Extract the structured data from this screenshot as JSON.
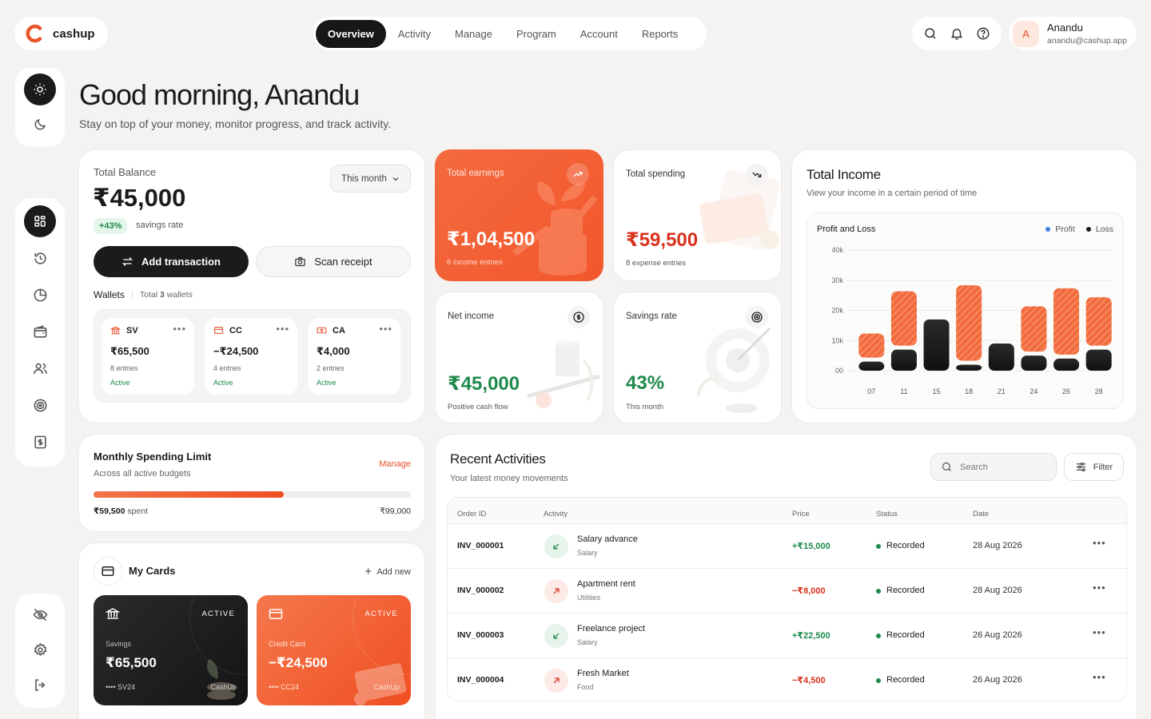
{
  "app": {
    "name": "cashup"
  },
  "nav": {
    "items": [
      "Overview",
      "Activity",
      "Manage",
      "Program",
      "Account",
      "Reports"
    ],
    "active": 0
  },
  "user": {
    "initial": "A",
    "name": "Anandu",
    "email": "anandu@cashup.app"
  },
  "greeting": {
    "title": "Good morning, Anandu",
    "subtitle": "Stay on top of your money, monitor progress, and track activity."
  },
  "balance": {
    "label": "Total Balance",
    "value": "₹45,000",
    "period": "This month",
    "badge": "+43%",
    "badge_text": "savings rate",
    "add_btn": "Add transaction",
    "scan_btn": "Scan receipt"
  },
  "wallets": {
    "title": "Wallets",
    "total_prefix": "Total",
    "total_count": "3",
    "total_suffix": "wallets",
    "items": [
      {
        "code": "SV",
        "value": "₹65,500",
        "entries": "8 entries",
        "status": "Active"
      },
      {
        "code": "CC",
        "value": "−₹24,500",
        "entries": "4 entries",
        "status": "Active"
      },
      {
        "code": "CA",
        "value": "₹4,000",
        "entries": "2 entries",
        "status": "Active"
      }
    ]
  },
  "stats": {
    "earnings": {
      "label": "Total earnings",
      "value": "₹1,04,500",
      "sub": "6 income entries"
    },
    "spending": {
      "label": "Total spending",
      "value": "₹59,500",
      "sub": "8 expense entries"
    },
    "net": {
      "label": "Net income",
      "value": "₹45,000",
      "sub": "Positive cash flow"
    },
    "savings": {
      "label": "Savings rate",
      "value": "43%",
      "sub": "This month"
    }
  },
  "income": {
    "title": "Total Income",
    "subtitle": "View your income in a certain period of time",
    "chart_title": "Profit and Loss",
    "legend_profit": "Profit",
    "legend_loss": "Loss"
  },
  "chart_data": {
    "type": "bar",
    "title": "Profit and Loss",
    "categories": [
      "07",
      "11",
      "15",
      "18",
      "21",
      "24",
      "26",
      "28"
    ],
    "y_ticks": [
      "00",
      "10k",
      "20k",
      "30k",
      "40k"
    ],
    "ylim": [
      0,
      40000
    ],
    "series": [
      {
        "name": "Profit",
        "values": [
          8000,
          18000,
          0,
          25000,
          0,
          15000,
          22000,
          16000
        ]
      },
      {
        "name": "Loss",
        "values": [
          3000,
          7000,
          17000,
          2000,
          9000,
          5000,
          4000,
          7000
        ]
      }
    ],
    "colors": {
      "Profit": "#f26a3b",
      "Loss": "#1e1e1e"
    },
    "legend": "top-right",
    "grid": true
  },
  "limit": {
    "title": "Monthly Spending Limit",
    "subtitle": "Across all active budgets",
    "manage": "Manage",
    "spent": "₹59,500",
    "spent_suffix": "spent",
    "total": "₹99,000",
    "progress": 0.6
  },
  "cards": {
    "title": "My Cards",
    "add": "Add new",
    "items": [
      {
        "status": "ACTIVE",
        "type": "Savings",
        "value": "₹65,500",
        "number": "•••• SV24",
        "brand": "CashUp"
      },
      {
        "status": "ACTIVE",
        "type": "Credit Card",
        "value": "−₹24,500",
        "number": "•••• CC24",
        "brand": "CashUp"
      }
    ]
  },
  "recent": {
    "title": "Recent Activities",
    "subtitle": "Your latest money movements",
    "search_placeholder": "Search",
    "filter": "Filter",
    "columns": [
      "Order ID",
      "Activity",
      "Price",
      "Status",
      "Date"
    ],
    "rows": [
      {
        "id": "INV_000001",
        "name": "Salary advance",
        "cat": "Salary",
        "price": "+₹15,000",
        "status": "Recorded",
        "date": "28 Aug 2026",
        "dir": "in"
      },
      {
        "id": "INV_000002",
        "name": "Apartment rent",
        "cat": "Utilities",
        "price": "−₹8,000",
        "status": "Recorded",
        "date": "28 Aug 2026",
        "dir": "out"
      },
      {
        "id": "INV_000003",
        "name": "Freelance project",
        "cat": "Salary",
        "price": "+₹22,500",
        "status": "Recorded",
        "date": "26 Aug 2026",
        "dir": "in"
      },
      {
        "id": "INV_000004",
        "name": "Fresh Market",
        "cat": "Food",
        "price": "−₹4,500",
        "status": "Recorded",
        "date": "26 Aug 2026",
        "dir": "out"
      }
    ]
  }
}
